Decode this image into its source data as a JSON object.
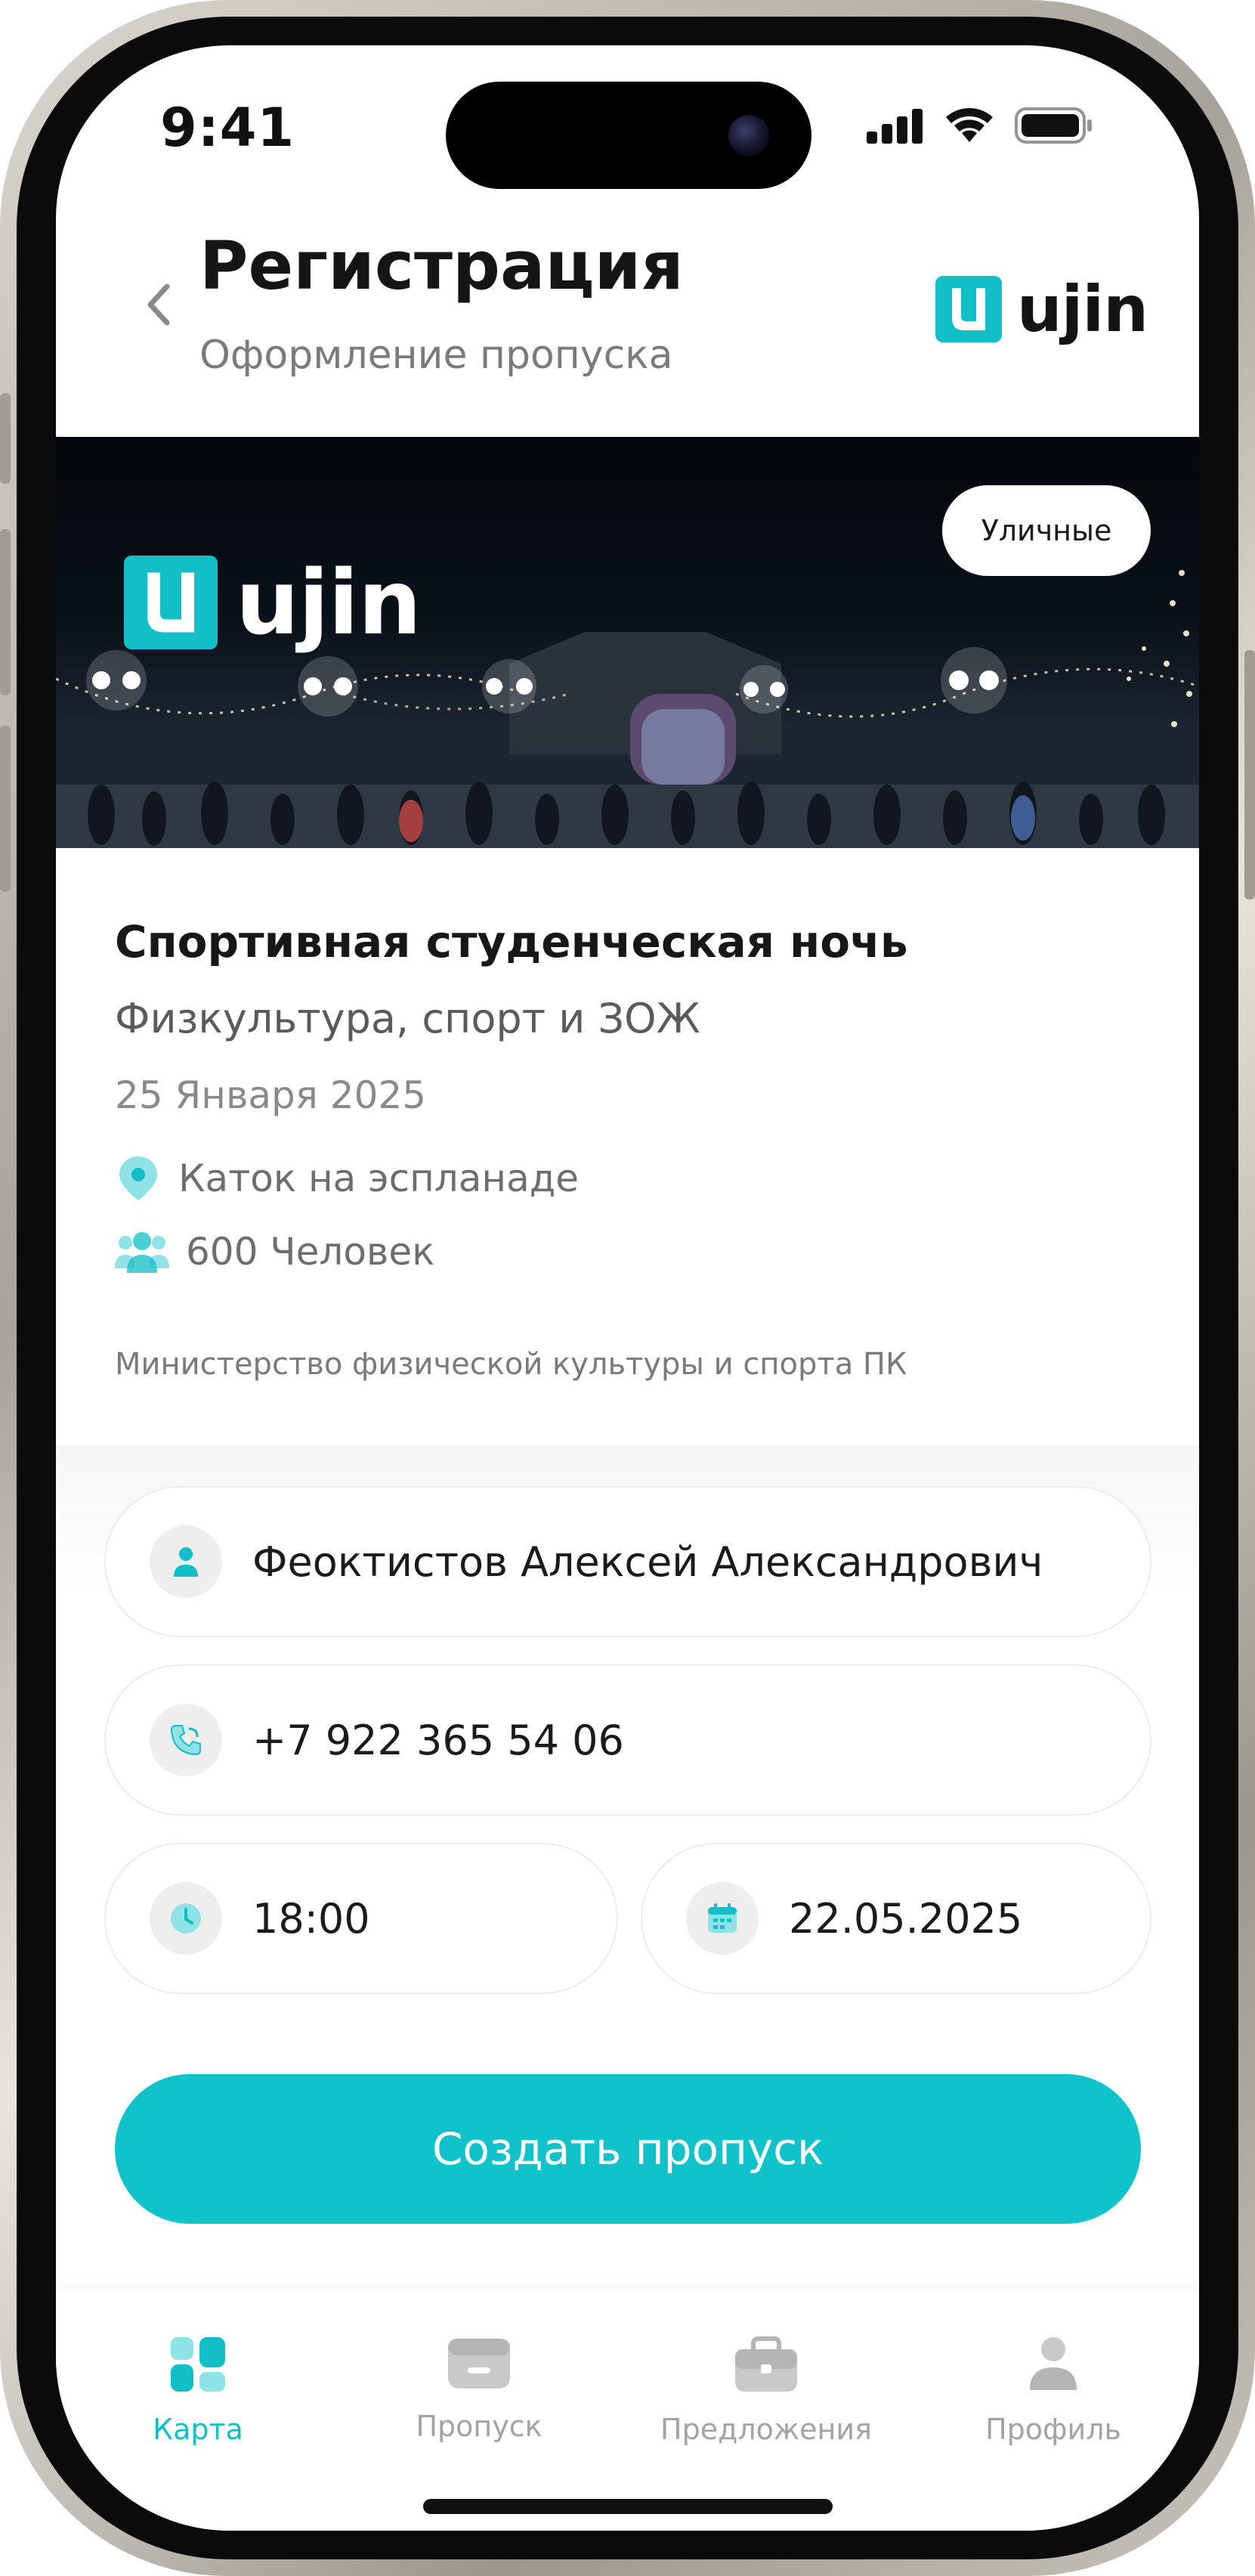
{
  "status_bar": {
    "time": "9:41"
  },
  "header": {
    "title": "Регистрация",
    "subtitle": "Оформление пропуска",
    "logo_text": "ujin"
  },
  "banner": {
    "tag": "Уличные",
    "logo_text": "ujin"
  },
  "event": {
    "title": "Спортивная студенческая ночь",
    "category": "Физкультура, спорт и ЗОЖ",
    "date": "25 Января 2025",
    "location": "Каток на эспланаде",
    "attendees": "600 Человек",
    "organizer": "Министерство физической культуры и спорта ПК"
  },
  "form": {
    "name": "Феоктистов Алексей Александрович",
    "phone": "+7 922 365 54 06",
    "time": "18:00",
    "date": "22.05.2025",
    "submit_label": "Создать пропуск"
  },
  "tabbar": {
    "items": [
      {
        "label": "Карта",
        "icon": "map-icon",
        "active": true
      },
      {
        "label": "Пропуск",
        "icon": "pass-icon",
        "active": false
      },
      {
        "label": "Предложения",
        "icon": "briefcase-icon",
        "active": false
      },
      {
        "label": "Профиль",
        "icon": "profile-icon",
        "active": false
      }
    ]
  },
  "colors": {
    "accent": "#12bfc6",
    "button": "#10c2c9",
    "text_primary": "#171717",
    "text_secondary": "#7b7b7b",
    "tab_inactive": "#a3a3a3"
  }
}
